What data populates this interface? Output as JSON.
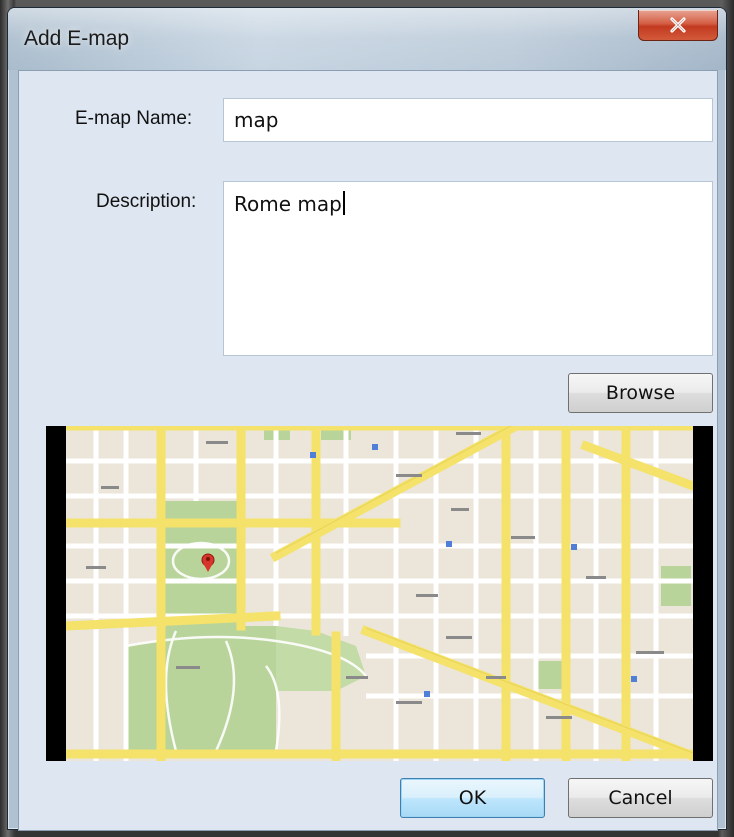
{
  "window": {
    "title": "Add E-map",
    "close_icon": "close-x-icon"
  },
  "form": {
    "name_label": "E-map Name:",
    "name_value": "map",
    "description_label": "Description:",
    "description_value": "Rome map"
  },
  "buttons": {
    "browse": "Browse",
    "ok": "OK",
    "cancel": "Cancel"
  },
  "map_preview": {
    "marker_icon": "map-pin-icon"
  },
  "colors": {
    "close_red": "#c23a1f",
    "ok_blue": "#3c7fb1",
    "road_yellow": "#f4e26a",
    "park_green": "#b9d49a"
  }
}
